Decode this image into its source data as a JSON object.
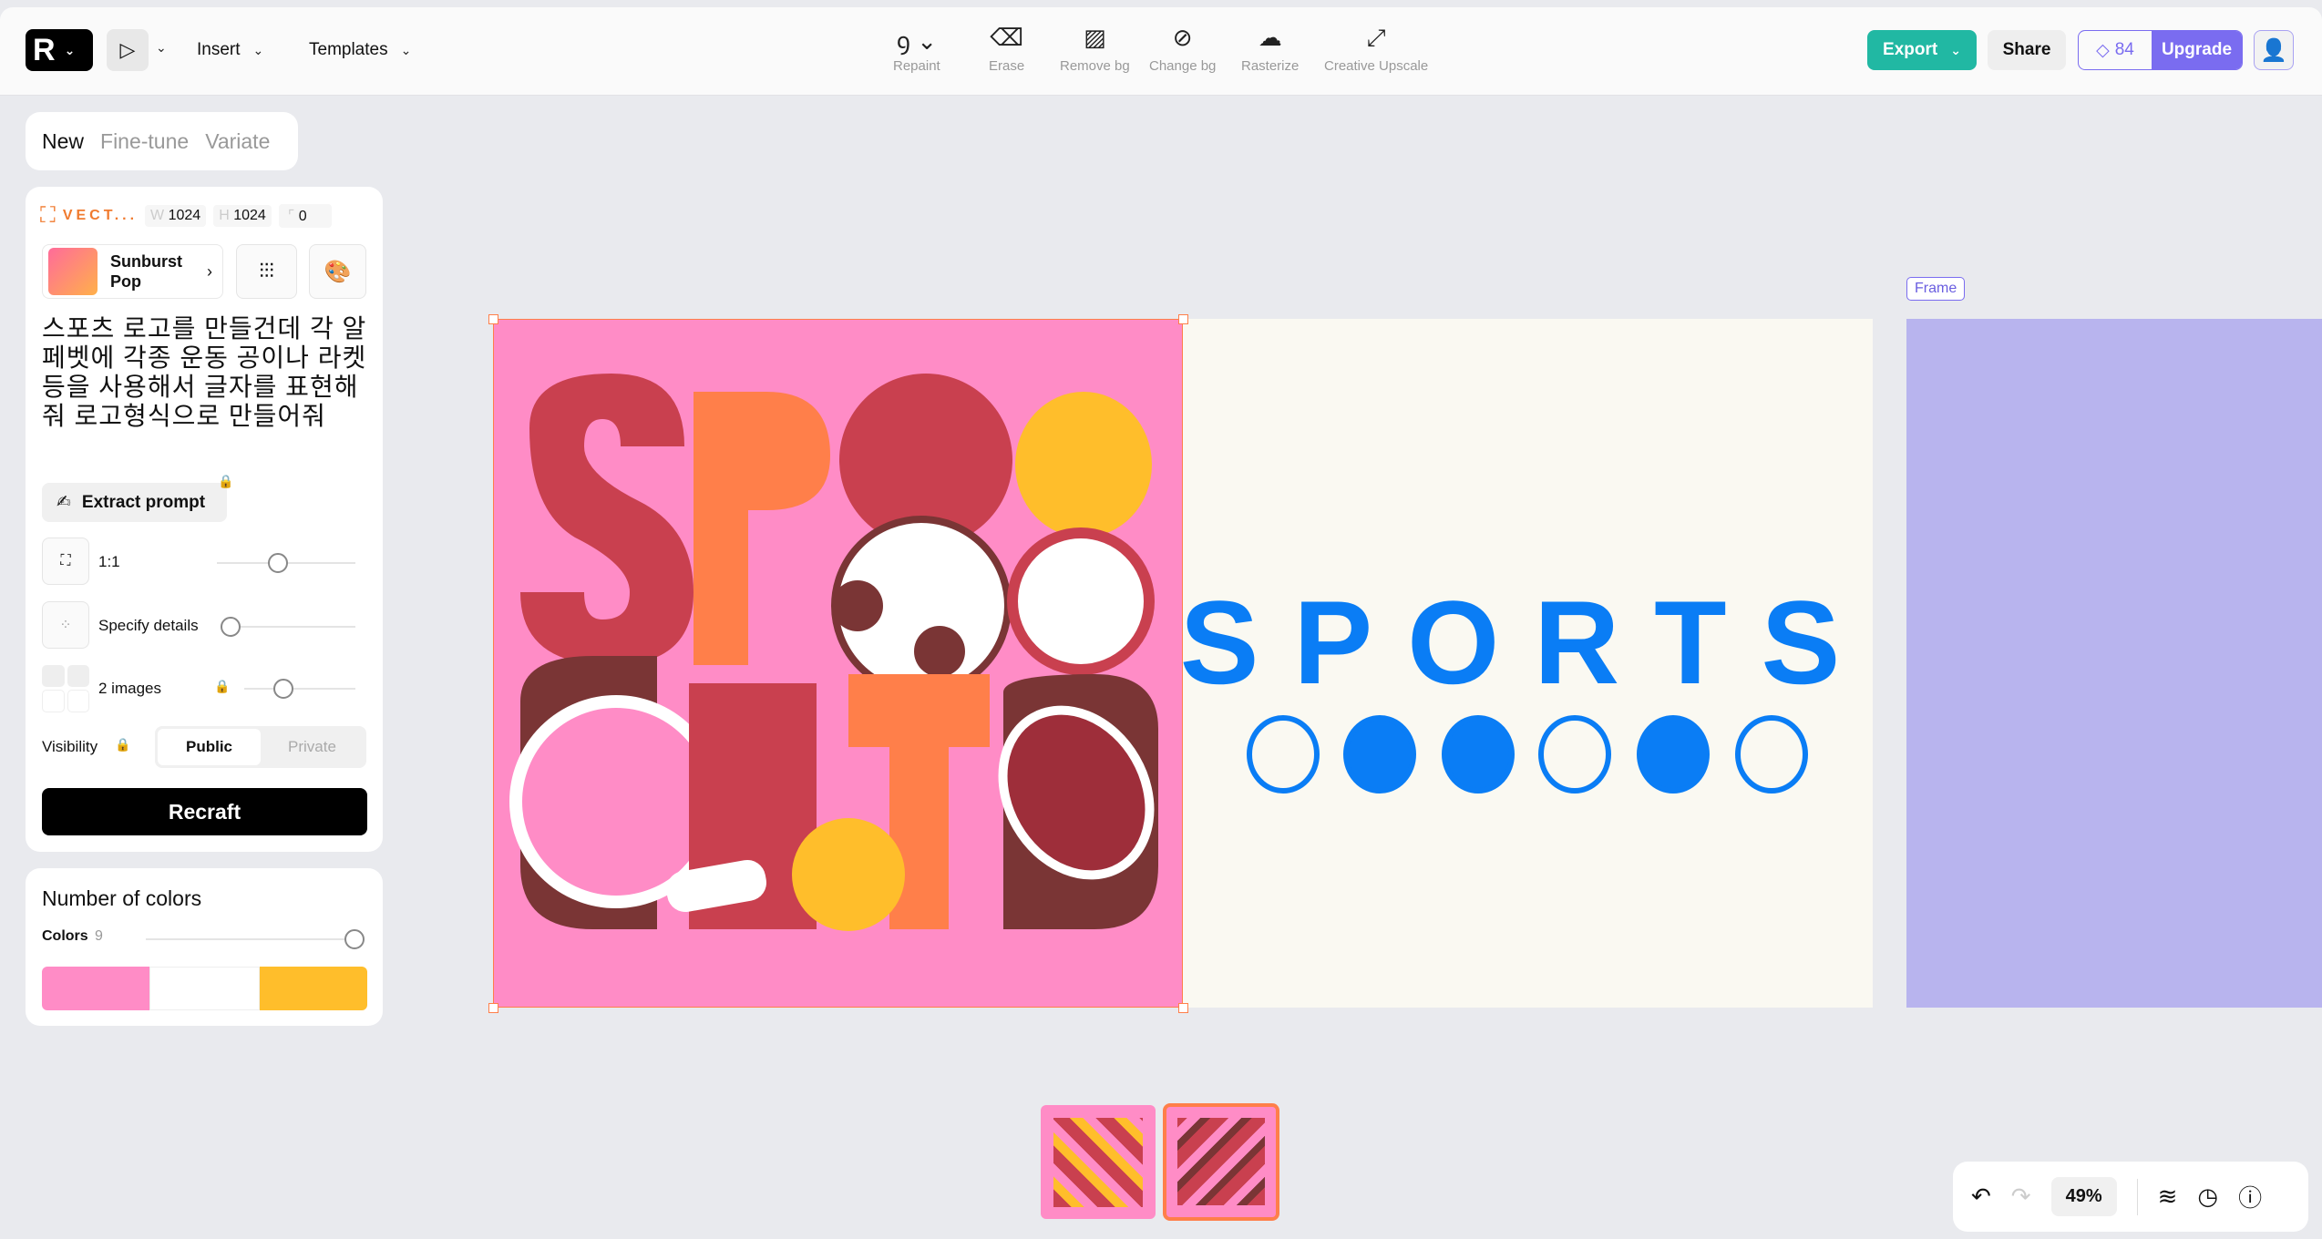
{
  "topbar": {
    "menu": [
      {
        "label": "Insert"
      },
      {
        "label": "Templates"
      }
    ],
    "tools": [
      {
        "label": "Repaint",
        "icon": "lasso-icon"
      },
      {
        "label": "Erase",
        "icon": "eraser-icon"
      },
      {
        "label": "Remove bg",
        "icon": "remove-bg-icon"
      },
      {
        "label": "Change bg",
        "icon": "change-bg-icon"
      },
      {
        "label": "Rasterize",
        "icon": "rasterize-icon"
      },
      {
        "label": "Creative Upscale",
        "icon": "upscale-icon"
      }
    ],
    "export": "Export",
    "share": "Share",
    "credits": "84",
    "upgrade": "Upgrade"
  },
  "panel": {
    "tabs": [
      "New",
      "Fine-tune",
      "Variate"
    ],
    "model": "VECT...",
    "w_label": "W",
    "w": "1024",
    "h_label": "H",
    "h": "1024",
    "radius": "0",
    "style_name": "Sunburst Pop",
    "prompt": "스포츠 로고를 만들건데 각 알페벳에 각종 운동 공이나 라켓 등을 사용해서 글자를 표현해줘 로고형식으로 만들어줘",
    "extract": "Extract prompt",
    "ratio": "1:1",
    "details": "Specify details",
    "images": "2 images",
    "visibility": "Visibility",
    "public": "Public",
    "private": "Private",
    "recraft": "Recraft",
    "colors_title": "Number of colors",
    "colors_label": "Colors",
    "colors_count": "9",
    "palette": [
      "#ff8cc6",
      "#ffffff",
      "#ffbe2b"
    ]
  },
  "canvas": {
    "frame_label": "Frame",
    "artwork_lettering": "SPORTS",
    "accent_blue": "#0a7df5",
    "pink": "#ff8cc6",
    "frame_color": "#b8b4ee"
  },
  "bottom": {
    "zoom": "49%"
  }
}
